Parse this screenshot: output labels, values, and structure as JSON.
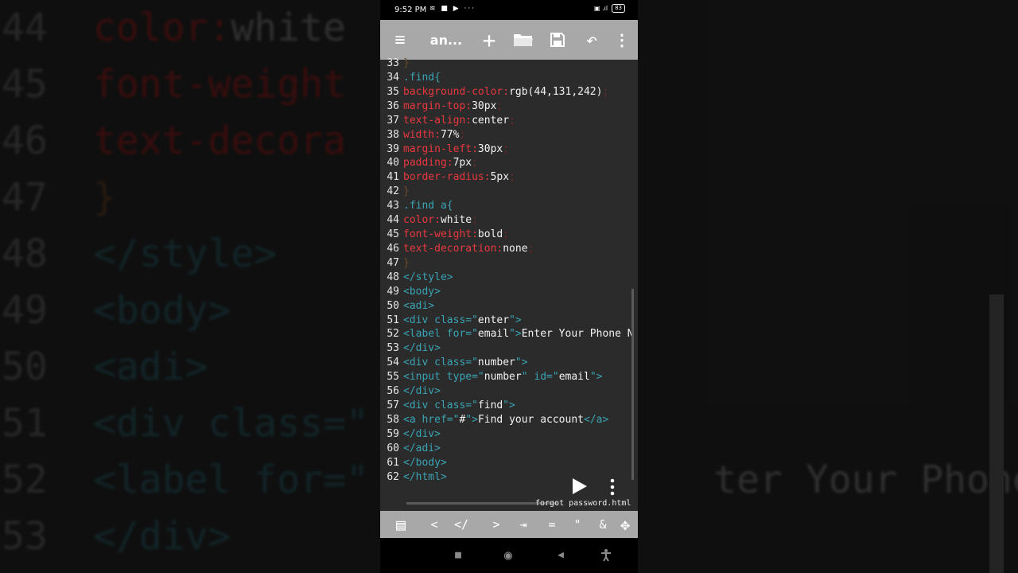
{
  "background": {
    "rows": [
      {
        "num": "44",
        "code": [
          {
            "t": "color:",
            "c": "#5a1515"
          },
          {
            "t": "white",
            "c": "#4a4a4a"
          }
        ]
      },
      {
        "num": "45",
        "code": [
          {
            "t": "font-weight",
            "c": "#5a1515"
          }
        ]
      },
      {
        "num": "46",
        "code": [
          {
            "t": "text-decora",
            "c": "#5a1515"
          }
        ]
      },
      {
        "num": "47",
        "code": [
          {
            "t": "}",
            "c": "#3d2a18"
          }
        ]
      },
      {
        "num": "48",
        "code": [
          {
            "t": "</style>",
            "c": "#1d3a40"
          }
        ]
      },
      {
        "num": "49",
        "code": [
          {
            "t": "<body>",
            "c": "#1d3a40"
          }
        ]
      },
      {
        "num": "50",
        "code": [
          {
            "t": "<adi>",
            "c": "#1d3a40"
          }
        ]
      },
      {
        "num": "51",
        "code": [
          {
            "t": "<div class=\"",
            "c": "#1d3a40"
          }
        ]
      },
      {
        "num": "52",
        "code": [
          {
            "t": "<label for=\"",
            "c": "#1d3a40"
          },
          {
            "t": "               ter Your Phone N",
            "c": "#4a4a4a"
          }
        ]
      },
      {
        "num": "53",
        "code": [
          {
            "t": "</div>",
            "c": "#1d3a40"
          }
        ]
      }
    ]
  },
  "statusbar": {
    "time": "9:52 PM",
    "left_icons": "≋ ■ ▶ ···",
    "right_icons": "▣ .ıl",
    "battery": "83"
  },
  "toolbar": {
    "menu_icon": "≡",
    "title": "an...",
    "add_icon": "+",
    "folder_icon": "folder",
    "save_icon": "save",
    "undo_icon": "↶",
    "more_icon": "⋮"
  },
  "editor": {
    "lines": [
      {
        "n": "33",
        "segs": [
          {
            "t": "}",
            "k": "brace"
          }
        ]
      },
      {
        "n": "34",
        "segs": [
          {
            "t": ".find{",
            "k": "sel"
          }
        ]
      },
      {
        "n": "35",
        "segs": [
          {
            "t": "background-color:",
            "k": "prop"
          },
          {
            "t": "rgb(44,131,242)",
            "k": "val"
          },
          {
            "t": ";",
            "k": "punct"
          }
        ]
      },
      {
        "n": "36",
        "segs": [
          {
            "t": "margin-top:",
            "k": "prop"
          },
          {
            "t": "30px",
            "k": "val"
          },
          {
            "t": ";",
            "k": "punct"
          }
        ]
      },
      {
        "n": "37",
        "segs": [
          {
            "t": "text-align:",
            "k": "prop"
          },
          {
            "t": "center",
            "k": "val"
          },
          {
            "t": ";",
            "k": "punct"
          }
        ]
      },
      {
        "n": "38",
        "segs": [
          {
            "t": "width:",
            "k": "prop"
          },
          {
            "t": "77%",
            "k": "val"
          },
          {
            "t": ";",
            "k": "punct"
          }
        ]
      },
      {
        "n": "39",
        "segs": [
          {
            "t": "margin-left:",
            "k": "prop"
          },
          {
            "t": "30px",
            "k": "val"
          },
          {
            "t": ";",
            "k": "punct"
          }
        ]
      },
      {
        "n": "40",
        "segs": [
          {
            "t": "padding:",
            "k": "prop"
          },
          {
            "t": "7px",
            "k": "val"
          },
          {
            "t": ";",
            "k": "punct"
          }
        ]
      },
      {
        "n": "41",
        "segs": [
          {
            "t": "border-radius:",
            "k": "prop"
          },
          {
            "t": "5px",
            "k": "val"
          },
          {
            "t": ";",
            "k": "punct"
          }
        ]
      },
      {
        "n": "42",
        "segs": [
          {
            "t": "}",
            "k": "brace"
          }
        ]
      },
      {
        "n": "43",
        "segs": [
          {
            "t": ".find a{",
            "k": "sel"
          }
        ]
      },
      {
        "n": "44",
        "segs": [
          {
            "t": "color:",
            "k": "prop"
          },
          {
            "t": "white",
            "k": "val"
          },
          {
            "t": ";",
            "k": "punct"
          }
        ]
      },
      {
        "n": "45",
        "segs": [
          {
            "t": "font-weight:",
            "k": "prop"
          },
          {
            "t": "bold",
            "k": "val"
          },
          {
            "t": ";",
            "k": "punct"
          }
        ]
      },
      {
        "n": "46",
        "segs": [
          {
            "t": "text-decoration:",
            "k": "prop"
          },
          {
            "t": "none",
            "k": "val"
          },
          {
            "t": ";",
            "k": "punct"
          }
        ]
      },
      {
        "n": "47",
        "segs": [
          {
            "t": "}",
            "k": "brace"
          }
        ]
      },
      {
        "n": "48",
        "segs": [
          {
            "t": "</style>",
            "k": "tag"
          }
        ]
      },
      {
        "n": "49",
        "segs": [
          {
            "t": "<body>",
            "k": "tag"
          }
        ]
      },
      {
        "n": "50",
        "segs": [
          {
            "t": "<adi>",
            "k": "tag"
          }
        ]
      },
      {
        "n": "51",
        "segs": [
          {
            "t": "<div class=\"",
            "k": "tag"
          },
          {
            "t": "enter",
            "k": "val"
          },
          {
            "t": "\">",
            "k": "tag"
          }
        ]
      },
      {
        "n": "52",
        "segs": [
          {
            "t": "<label for=\"",
            "k": "tag"
          },
          {
            "t": "email",
            "k": "val"
          },
          {
            "t": "\">",
            "k": "tag"
          },
          {
            "t": "Enter Your Phone N",
            "k": "val"
          }
        ]
      },
      {
        "n": "53",
        "segs": [
          {
            "t": "</div>",
            "k": "tag"
          }
        ]
      },
      {
        "n": "54",
        "segs": [
          {
            "t": "<div class=\"",
            "k": "tag"
          },
          {
            "t": "number",
            "k": "val"
          },
          {
            "t": "\">",
            "k": "tag"
          }
        ]
      },
      {
        "n": "55",
        "segs": [
          {
            "t": "<input type=\"",
            "k": "tag"
          },
          {
            "t": "number",
            "k": "val"
          },
          {
            "t": "\" id=\"",
            "k": "tag"
          },
          {
            "t": "email",
            "k": "val"
          },
          {
            "t": "\">",
            "k": "tag"
          }
        ]
      },
      {
        "n": "56",
        "segs": [
          {
            "t": "</div>",
            "k": "tag"
          }
        ]
      },
      {
        "n": "57",
        "segs": [
          {
            "t": "<div class=\"",
            "k": "tag"
          },
          {
            "t": "find",
            "k": "val"
          },
          {
            "t": "\">",
            "k": "tag"
          }
        ]
      },
      {
        "n": "58",
        "segs": [
          {
            "t": "<a href=\"",
            "k": "tag"
          },
          {
            "t": "#",
            "k": "val"
          },
          {
            "t": "\">",
            "k": "tag"
          },
          {
            "t": "Find your account",
            "k": "val"
          },
          {
            "t": "</a>",
            "k": "tag"
          }
        ]
      },
      {
        "n": "59",
        "segs": [
          {
            "t": "</div>",
            "k": "tag"
          }
        ]
      },
      {
        "n": "60",
        "segs": [
          {
            "t": "</adi>",
            "k": "tag"
          }
        ]
      },
      {
        "n": "61",
        "segs": [
          {
            "t": "</body>",
            "k": "tag"
          }
        ]
      },
      {
        "n": "62",
        "segs": [
          {
            "t": "</html>",
            "k": "tag"
          }
        ]
      }
    ],
    "filename": "forgot password.html",
    "run_icon": "play",
    "more_icon": "⋮"
  },
  "symbols": {
    "items": [
      {
        "label": "▤",
        "name": "snippets-icon"
      },
      {
        "label": "<",
        "name": "symbol-lt"
      },
      {
        "label": "</",
        "name": "symbol-close-tag"
      },
      {
        "label": ">",
        "name": "symbol-gt"
      },
      {
        "label": "⇥",
        "name": "symbol-tab"
      },
      {
        "label": "=",
        "name": "symbol-equals"
      },
      {
        "label": "\"",
        "name": "symbol-quote"
      },
      {
        "label": "&",
        "name": "symbol-ampersand"
      },
      {
        "label": "✥",
        "name": "cursor-move-icon"
      }
    ]
  },
  "navbar": {
    "recent_icon": "■",
    "home_icon": "◉",
    "back_icon": "◀",
    "accessibility_icon": "accessibility"
  },
  "colors": {
    "tag": "#39a3b4",
    "property": "#e8383f",
    "value": "#f2f2f2",
    "toolbar": "#a8a8a8",
    "editor_bg": "#2b2b2b"
  }
}
